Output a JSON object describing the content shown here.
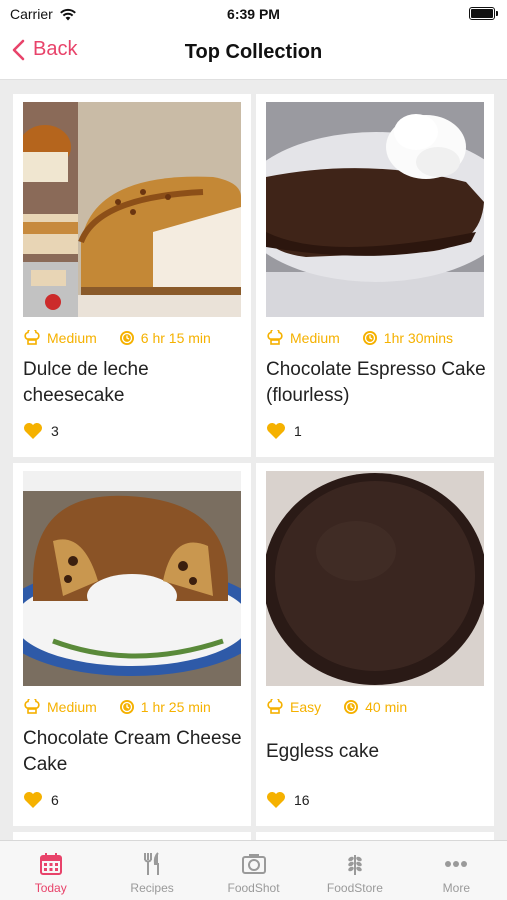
{
  "status": {
    "carrier": "Carrier",
    "time": "6:39 PM"
  },
  "nav": {
    "back_label": "Back",
    "title": "Top Collection"
  },
  "recipes": [
    {
      "difficulty": "Medium",
      "time": "6 hr 15 min",
      "title": "Dulce de leche cheesecake",
      "likes": "3"
    },
    {
      "difficulty": "Medium",
      "time": "1hr 30mins",
      "title": "Chocolate Espresso Cake (flourless)",
      "likes": "1"
    },
    {
      "difficulty": "Medium",
      "time": "1 hr 25 min",
      "title": "Chocolate Cream Cheese Cake",
      "likes": "6"
    },
    {
      "difficulty": "Easy",
      "time": "40 min",
      "title": "Eggless cake",
      "likes": "16"
    }
  ],
  "tabs": [
    {
      "label": "Today",
      "icon": "calendar-icon"
    },
    {
      "label": "Recipes",
      "icon": "fork-knife-icon"
    },
    {
      "label": "FoodShot",
      "icon": "camera-icon"
    },
    {
      "label": "FoodStore",
      "icon": "wheat-icon"
    },
    {
      "label": "More",
      "icon": "ellipsis-icon"
    }
  ],
  "colors": {
    "accent": "#e8436a",
    "meta": "#f5b100",
    "inactive": "#9a9a9a"
  }
}
